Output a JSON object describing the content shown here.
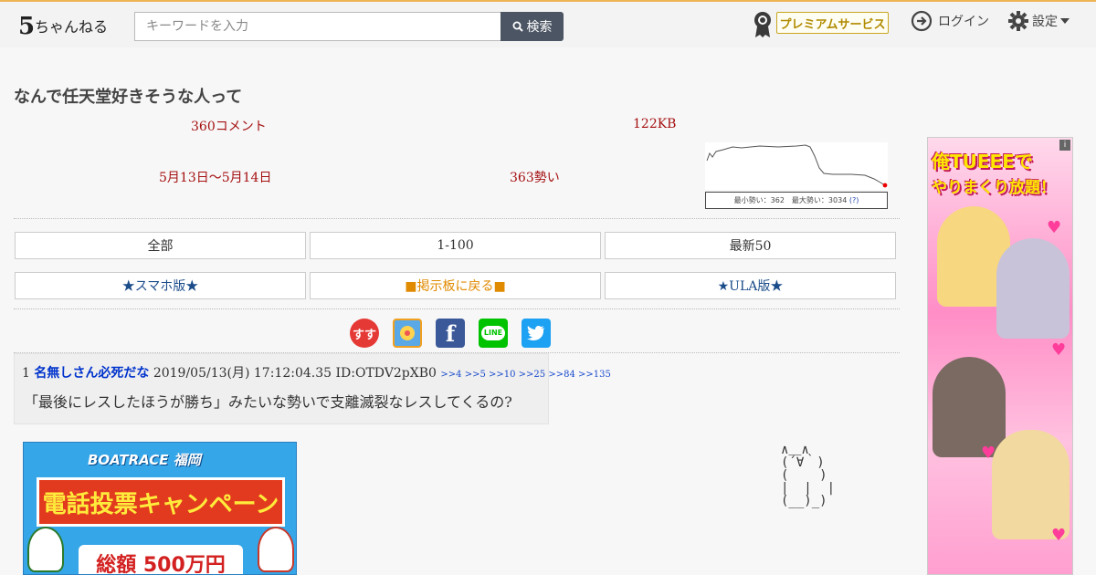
{
  "header": {
    "logo_text": "5ちゃんねる",
    "search_placeholder": "キーワードを入力",
    "search_button": "検索",
    "premium_label": "プレミアムサービス",
    "login_label": "ログイン",
    "settings_label": "設定"
  },
  "thread": {
    "title": "なんで任天堂好きそうな人って",
    "comments": "360コメント",
    "size": "122KB",
    "date_range": "5月13日〜5月14日",
    "momentum": "363勢い",
    "graph_label": "最小勢い：362　最大勢い：3034",
    "graph_help": "(?)",
    "graph_momentum": {
      "min": 362,
      "max": 3034
    }
  },
  "nav": {
    "all": "全部",
    "range": "1-100",
    "latest": "最新50",
    "smartphone": "★スマホ版★",
    "back_to_board": "■掲示板に戻る■",
    "ula": "★ULA版★"
  },
  "social": {
    "items": [
      {
        "name": "susu",
        "label": "すす",
        "color": "#e53935"
      },
      {
        "name": "matome",
        "label": "",
        "color": "#5aa9e6"
      },
      {
        "name": "facebook",
        "label": "f",
        "color": "#3b5998"
      },
      {
        "name": "line",
        "label": "LINE",
        "color": "#00c300"
      },
      {
        "name": "twitter",
        "label": "",
        "color": "#1da1f2"
      }
    ]
  },
  "post": {
    "number": "1",
    "author": "名無しさん必死だな",
    "datetime": "2019/05/13(月) 17:12:04.35",
    "id": "ID:OTDV2pXB0",
    "reply_links": [
      ">>4",
      ">>5",
      ">>10",
      ">>25",
      ">>84",
      ">>135"
    ],
    "body": "「最後にレスしたほうが勝ち」みたいな勢いで支離滅裂なレスしてくるの?"
  },
  "ads": {
    "boat_brand": "BOATRACE",
    "boat_place": "福岡",
    "boat_headline": "電話投票キャンペーン",
    "boat_sub": "総額 500万円",
    "side_line1": "俺TUEEEで",
    "side_line2": "やりまくり放題！",
    "side_badge": "i"
  },
  "ascii_art": "∧＿∧\n(´∀｀)\n(    )\n|  |  |\n(__)_)"
}
